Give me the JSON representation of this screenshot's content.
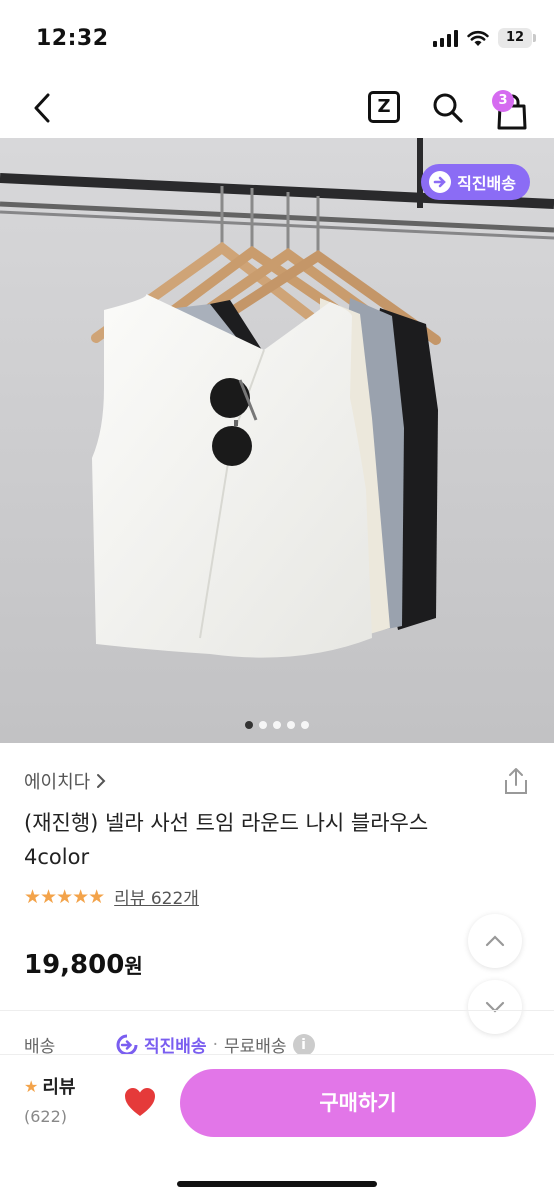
{
  "status_bar": {
    "time": "12:32",
    "battery": "12"
  },
  "nav": {
    "cart_count": "3",
    "z_label": "Z"
  },
  "hero": {
    "badge_text": "직진배송",
    "image_count": 5,
    "active_index": 0
  },
  "product": {
    "brand": "에이치다",
    "title": "(재진행) 넬라 사선 트임 라운드 나시 블라우스 4color",
    "stars": "★★★★★",
    "review_link": "리뷰 622개",
    "price_number": "19,800",
    "price_unit": "원"
  },
  "shipping": {
    "label": "배송",
    "direct": "직진배송",
    "separator": "·",
    "free": "무료배송"
  },
  "bottom": {
    "review_title": "리뷰",
    "review_count": "(622)",
    "buy_label": "구매하기"
  },
  "colors": {
    "accent_purple": "#8b6cf5",
    "buy_pink": "#e276e8",
    "star": "#f3a34a",
    "heart": "#e53a3a"
  }
}
